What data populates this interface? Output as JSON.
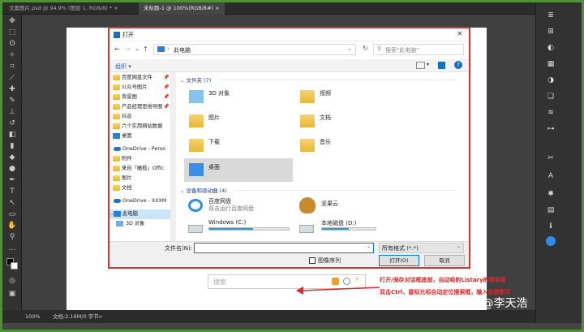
{
  "ps": {
    "tabs": [
      "文案图片.psd @ 94.9% (图层 1, RGB/8) *",
      "未标题-1 @ 100%(RGB/8#)"
    ],
    "tab_close": "×",
    "status_zoom": "100%",
    "status_doc": "文档:2.16M/0 字节",
    "status_arrow": ">"
  },
  "dialog": {
    "title": "打开",
    "close": "×",
    "breadcrumb_root": "此电脑",
    "search_placeholder": "搜索\"此电脑\"",
    "organize": "组织 ▾",
    "sidebar": [
      {
        "label": "百度网盘文件",
        "pin": true,
        "type": "folder"
      },
      {
        "label": "公众号图片",
        "pin": true,
        "type": "folder"
      },
      {
        "label": "背景图",
        "pin": true,
        "type": "folder"
      },
      {
        "label": "产品经理思维导图",
        "pin": true,
        "type": "folder"
      },
      {
        "label": "抖音",
        "pin": false,
        "type": "folder"
      },
      {
        "label": "六个实用网站数据",
        "pin": false,
        "type": "folder"
      },
      {
        "label": "桌面",
        "pin": false,
        "type": "desktop"
      },
      {
        "label": "OneDrive - Perso",
        "pin": false,
        "type": "cloud"
      },
      {
        "label": "附件",
        "pin": false,
        "type": "folder"
      },
      {
        "label": "来自「橄榄」Offic",
        "pin": false,
        "type": "folder"
      },
      {
        "label": "图片",
        "pin": false,
        "type": "folder"
      },
      {
        "label": "文档",
        "pin": false,
        "type": "folder"
      },
      {
        "label": "OneDrive - XXXM",
        "pin": false,
        "type": "cloud"
      },
      {
        "label": "此电脑",
        "pin": false,
        "type": "pc"
      },
      {
        "label": "3D 对象",
        "pin": false,
        "type": "folder"
      }
    ],
    "folders_header": "文件夹 (7)",
    "folders": [
      "3D 对象",
      "视频",
      "图片",
      "文档",
      "下载",
      "音乐",
      "桌面"
    ],
    "devices_header": "设备和驱动器 (4)",
    "devices": [
      {
        "name": "百度网盘",
        "sub": "双击运行百度网盘",
        "type": "app"
      },
      {
        "name": "坚果云",
        "sub": "",
        "type": "nut"
      },
      {
        "name": "Windows (C:)",
        "sub": "",
        "type": "drive",
        "used": 0.55
      },
      {
        "name": "本地磁盘 (D:)",
        "sub": "",
        "type": "drive",
        "used": 0.5
      }
    ],
    "filename_label": "文件名(N):",
    "filename_value": "",
    "filetype": "所有格式 (*.*)",
    "sequence_label": "图像序列",
    "open_button": "打开(O)",
    "cancel_button": "取消"
  },
  "doc": {
    "search_placeholder": "搜索"
  },
  "annotation": {
    "line1": "打开/保存对话框底部，自动吸附Listary的搜索框",
    "line2": "双击Ctrl、鼠标光标自动定位搜索框，输入名称即可"
  },
  "watermark": "知乎 @李天浩",
  "colors": {
    "highlight_border": "#d0342c",
    "annotation": "#e0262a",
    "accent": "#0078d7"
  }
}
